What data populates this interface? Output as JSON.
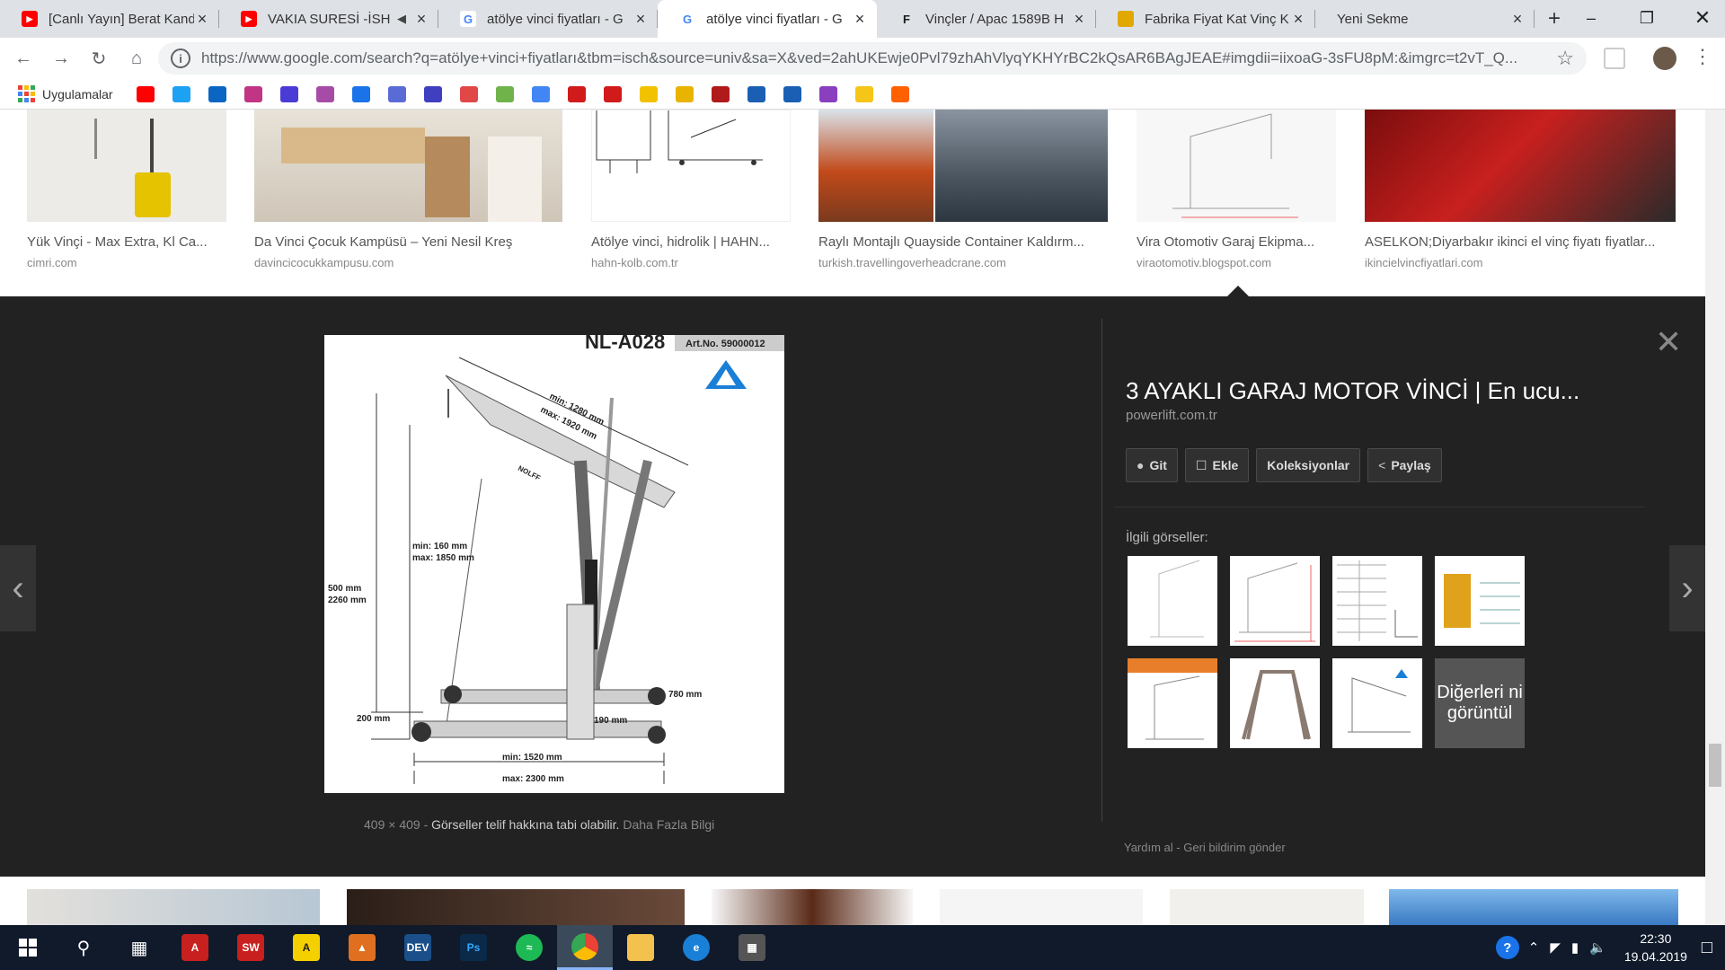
{
  "tabs": [
    {
      "title": "[Canlı Yayın] Berat Kandi",
      "icon": "youtube-icon",
      "color": "#ff0000"
    },
    {
      "title": "VAKIA SURESİ -İSH",
      "icon": "youtube-icon",
      "color": "#ff0000",
      "muted": true
    },
    {
      "title": "atölye vinci fiyatları - G",
      "icon": "google-icon",
      "color": "#4285f4"
    },
    {
      "title": "atölye vinci fiyatları - G",
      "icon": "google-icon",
      "color": "#4285f4",
      "active": true
    },
    {
      "title": "Vinçler / Apac 1589B H",
      "icon": "f-icon",
      "color": "#1a1a1a"
    },
    {
      "title": "Fabrika Fiyat Kat Vinç K",
      "icon": "site-icon",
      "color": "#e0a800"
    },
    {
      "title": "Yeni Sekme",
      "icon": "",
      "color": ""
    }
  ],
  "address": {
    "url": "https://www.google.com/search?q=atölye+vinci+fiyatları&tbm=isch&source=univ&sa=X&ved=2ahUKEwje0Pvl79zhAhVlyqYKHYrBC2kQsAR6BAgJEAE#imgdii=iixoaG-3sFU8pM:&imgrc=t2vT_Q..."
  },
  "bookmarks": {
    "apps_label": "Uygulamalar",
    "items": [
      {
        "icon": "youtube-icon",
        "color": "#ff0000"
      },
      {
        "icon": "twitter-icon",
        "color": "#1da1f2"
      },
      {
        "icon": "linkedin-icon",
        "color": "#0a66c2"
      },
      {
        "icon": "instagram-icon",
        "color": "#c13584"
      },
      {
        "icon": "play-icon",
        "color": "#4b3bd6"
      },
      {
        "icon": "circle-icon",
        "color": "#a64ca6"
      },
      {
        "icon": "bookmark-icon",
        "color": "#1a73e8"
      },
      {
        "icon": "globe-icon",
        "color": "#5b6bd6"
      },
      {
        "icon": "a-icon",
        "color": "#3f3fbf"
      },
      {
        "icon": "swirl-icon",
        "color": "#e04848"
      },
      {
        "icon": "grid-icon",
        "color": "#6fb34a"
      },
      {
        "icon": "translate-icon",
        "color": "#4285f4"
      },
      {
        "icon": "news-icon",
        "color": "#d11a1a"
      },
      {
        "icon": "u-icon",
        "color": "#d11a1a"
      },
      {
        "icon": "note-icon",
        "color": "#f2c200"
      },
      {
        "icon": "ne-icon",
        "color": "#e8b400"
      },
      {
        "icon": "1k-icon",
        "color": "#b11a1a"
      },
      {
        "icon": "doc-icon",
        "color": "#1a5fb4"
      },
      {
        "icon": "hd-icon",
        "color": "#1a5fb4"
      },
      {
        "icon": "diamond-icon",
        "color": "#8a3fbf"
      },
      {
        "icon": "imdb-icon",
        "color": "#f5c518"
      },
      {
        "icon": "hb-icon",
        "color": "#ff6000"
      }
    ]
  },
  "results": [
    {
      "title": "Yük Vinçi - Max Extra, Kl Ca...",
      "source": "cimri.com"
    },
    {
      "title": "Da Vinci Çocuk Kampüsü – Yeni Nesil Kreş",
      "source": "davincicocukkampusu.com"
    },
    {
      "title": "Atölye vinci, hidrolik | HAHN...",
      "source": "hahn-kolb.com.tr"
    },
    {
      "title": "Raylı Montajlı Quayside Container Kaldırm...",
      "source": "turkish.travellingoverheadcrane.com"
    },
    {
      "title": "Vira Otomotiv Garaj Ekipma...",
      "source": "viraotomotiv.blogspot.com"
    },
    {
      "title": "ASELKON;Diyarbakır ikinci el vinç fiyatı fiyatlar...",
      "source": "ikincielvincfiyatlari.com"
    }
  ],
  "preview": {
    "title": "3 AYAKLI GARAJ MOTOR VİNCİ | En ucu...",
    "site": "powerlift.com.tr",
    "buttons": {
      "git": "Git",
      "ekle": "Ekle",
      "koleksiyonlar": "Koleksiyonlar",
      "paylas": "Paylaş"
    },
    "related_label": "İlgili görseller:",
    "more_label": "Diğerleri ni görüntül",
    "size": "409 × 409",
    "copyright": "Görseller telif hakkına tabi olabilir.",
    "more_info": "Daha Fazla Bilgi",
    "help": "Yardım al",
    "feedback": "Geri bildirim gönder",
    "image_text": {
      "model": "NL-A028",
      "artno": "Art.No. 59000012",
      "brand": "NOLFF",
      "boom": "min: 1280 mm",
      "boom_max": "max: 1920 mm",
      "lift_min": "min: 160 mm",
      "lift_max": "max: 1850 mm",
      "height_a": "500 mm",
      "height_b": "2260 mm",
      "ground": "200 mm",
      "leg_w": "190 mm",
      "leg_d": "780 mm",
      "len_min": "min: 1520 mm",
      "len_max": "max: 2300 mm"
    }
  },
  "taskbar": {
    "time": "22:30",
    "date": "19.04.2019"
  }
}
